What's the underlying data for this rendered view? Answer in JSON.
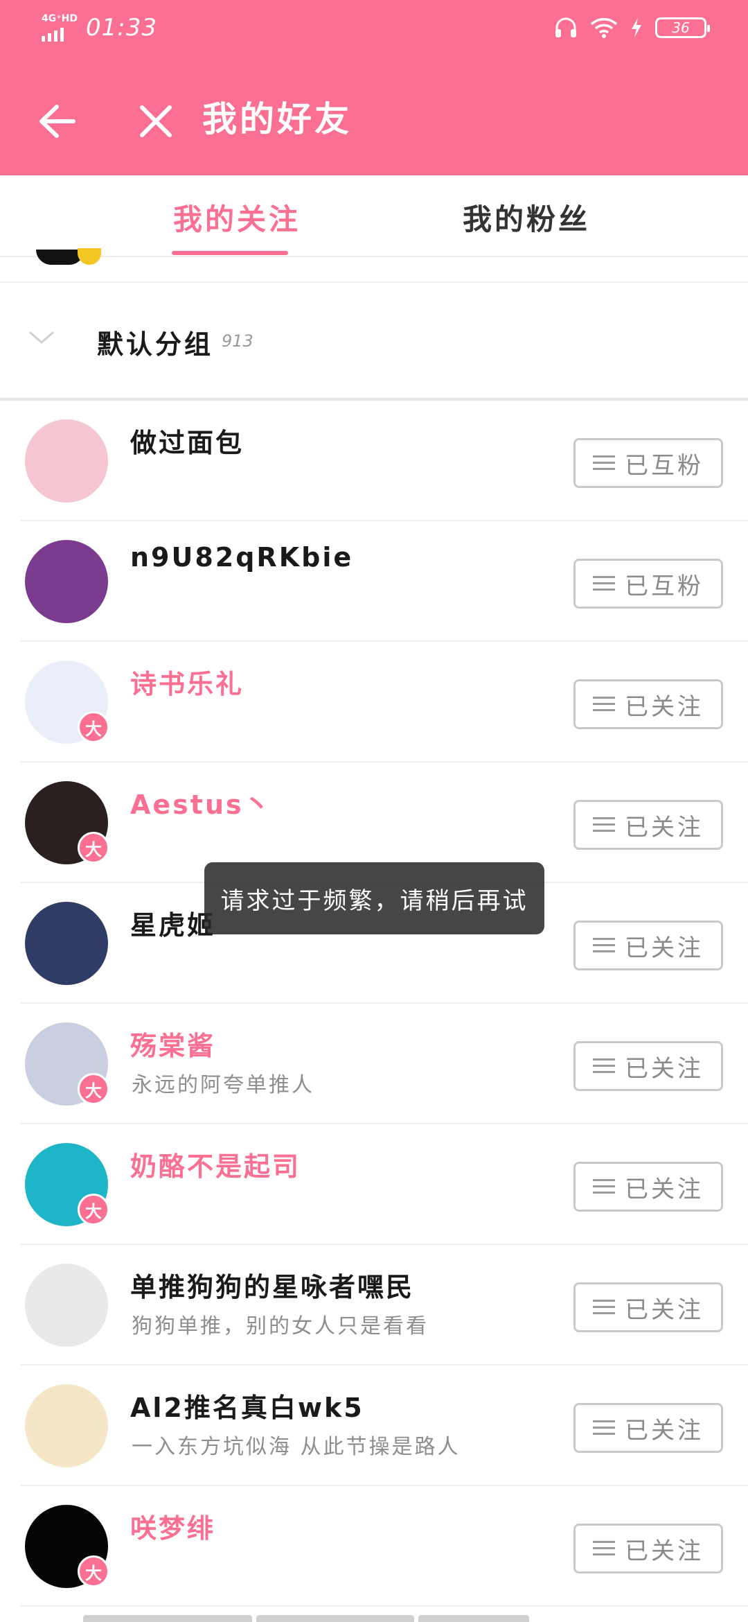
{
  "status_bar": {
    "network": "4G⁺HD",
    "time": "01:33",
    "battery": "36",
    "icons": [
      "signal-icon",
      "headphones-icon",
      "wifi-icon",
      "charging-icon",
      "battery-icon"
    ]
  },
  "app_bar": {
    "title": "我的好友",
    "icons": [
      "back-arrow-icon",
      "close-icon"
    ]
  },
  "tabs": [
    {
      "label": "我的关注",
      "active": true
    },
    {
      "label": "我的粉丝",
      "active": false
    }
  ],
  "group": {
    "title": "默认分组",
    "count": "913"
  },
  "toast": "请求过于频繁，请稍后再试",
  "colors": {
    "brand": "#fb6f93",
    "vip_name": "#fb6f93",
    "text": "#1a1a1a",
    "subtle": "#8e8e8e"
  },
  "list": [
    {
      "name": "做过面包",
      "signature": "",
      "button": "已互粉",
      "vip": false,
      "avatar_color": "#f6c5d2"
    },
    {
      "name": "n9U82qRKbie",
      "signature": "",
      "button": "已互粉",
      "vip": false,
      "avatar_color": "#7b3b8e"
    },
    {
      "name": "诗书乐礼",
      "signature": "",
      "button": "已关注",
      "vip": true,
      "vip_badge": "大",
      "avatar_color": "#e9eef8"
    },
    {
      "name": "Aestus丶",
      "signature": "",
      "button": "已关注",
      "vip": true,
      "vip_badge": "大",
      "avatar_color": "#2b2020"
    },
    {
      "name": "星虎姬",
      "signature": "",
      "button": "已关注",
      "vip": false,
      "avatar_color": "#2f3d66"
    },
    {
      "name": "殇棠酱",
      "signature": "永远的阿夸单推人",
      "button": "已关注",
      "vip": true,
      "vip_badge": "大",
      "avatar_color": "#c9cfe0"
    },
    {
      "name": "奶酪不是起司",
      "signature": "",
      "button": "已关注",
      "vip": true,
      "vip_badge": "大",
      "avatar_color": "#1fb5c9"
    },
    {
      "name": "单推狗狗的星咏者嘿民",
      "signature": "狗狗单推，别的女人只是看看",
      "button": "已关注",
      "vip": false,
      "avatar_color": "#e9e9e9"
    },
    {
      "name": "Al2推名真白wk5",
      "signature": "一入东方坑似海 从此节操是路人",
      "button": "已关注",
      "vip": false,
      "avatar_color": "#f5e6c8"
    },
    {
      "name": "咲梦绯",
      "signature": "",
      "button": "已关注",
      "vip": true,
      "vip_badge": "大",
      "avatar_color": "#050505"
    }
  ]
}
